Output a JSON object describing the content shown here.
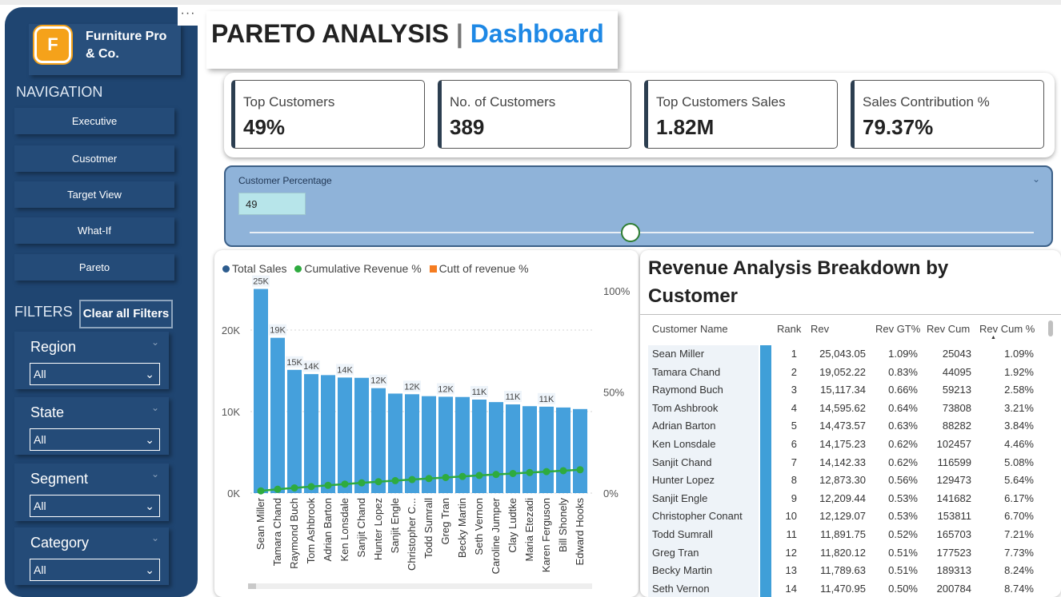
{
  "sidebar": {
    "more": "···",
    "logo_letter": "F",
    "company_line1": "Furniture Pro",
    "company_line2": "& Co.",
    "nav_title": "NAVIGATION",
    "nav": [
      "Executive",
      "Cusotmer",
      "Target View",
      "What-If",
      "Pareto"
    ],
    "filters_title": "FILTERS",
    "clear_label": "Clear all Filters",
    "filters": [
      {
        "label": "Region",
        "value": "All"
      },
      {
        "label": "State",
        "value": "All"
      },
      {
        "label": "Segment",
        "value": "All"
      },
      {
        "label": "Category",
        "value": "All"
      }
    ]
  },
  "header": {
    "main": "PARETO ANALYSIS",
    "sep": " | ",
    "sub": "Dashboard"
  },
  "kpis": [
    {
      "label": "Top Customers",
      "value": "49%"
    },
    {
      "label": "No. of Customers",
      "value": "389"
    },
    {
      "label": "Top Customers Sales",
      "value": "1.82M"
    },
    {
      "label": "Sales Contribution %",
      "value": "79.37%"
    }
  ],
  "slicer": {
    "title": "Customer Percentage",
    "value": "49",
    "position": 0.49
  },
  "colors": {
    "sidebar": "#1f4571",
    "bar": "#45a0dc",
    "cumulative": "#2eab3f",
    "cutoff": "#f57c21",
    "accent": "#1e88e5"
  },
  "chart_data": {
    "type": "bar",
    "legend": [
      "Total Sales",
      "Cumulative Revenue %",
      "Cutt of revenue %"
    ],
    "categories": [
      "Sean Miller",
      "Tamara Chand",
      "Raymond Buch",
      "Tom Ashbrook",
      "Adrian Barton",
      "Ken Lonsdale",
      "Sanjit Chand",
      "Hunter Lopez",
      "Sanjit Engle",
      "Christopher C...",
      "Todd Sumrall",
      "Greg Tran",
      "Becky Martin",
      "Seth Vernon",
      "Caroline Jumper",
      "Clay Ludtke",
      "Maria Etezadi",
      "Karen Ferguson",
      "Bill Shonely",
      "Edward Hooks"
    ],
    "series": [
      {
        "name": "Total Sales",
        "values": [
          25043,
          19052,
          15117,
          14596,
          14474,
          14175,
          14142,
          12873,
          12209,
          12129,
          11892,
          11820,
          11790,
          11471,
          11165,
          10880,
          10664,
          10604,
          10502,
          10311
        ]
      },
      {
        "name": "Cumulative Revenue %",
        "values": [
          1.09,
          1.92,
          2.58,
          3.21,
          3.84,
          4.46,
          5.08,
          5.64,
          6.17,
          6.7,
          7.21,
          7.73,
          8.24,
          8.74,
          9.23,
          9.7,
          10.17,
          10.63,
          11.09,
          11.54
        ]
      }
    ],
    "data_labels": [
      "25K",
      "19K",
      "15K",
      "14K",
      "",
      "14K",
      "",
      "12K",
      "",
      "12K",
      "",
      "12K",
      "",
      "11K",
      "",
      "11K",
      "",
      "11K",
      "",
      ""
    ],
    "y_ticks": [
      "0K",
      "10K",
      "20K"
    ],
    "y2_ticks": [
      "0%",
      "50%",
      "100%"
    ],
    "ylim": [
      0,
      25000
    ],
    "y2lim": [
      0,
      100
    ],
    "legend_position": "top-left"
  },
  "table": {
    "title": "Revenue Analysis Breakdown by Customer",
    "columns": [
      "Customer Name",
      "Rank",
      "Rev",
      "Rev GT%",
      "Rev Cum",
      "Rev Cum %"
    ],
    "rows": [
      [
        "Sean Miller",
        "1",
        "25,043.05",
        "1.09%",
        "25043",
        "1.09%"
      ],
      [
        "Tamara Chand",
        "2",
        "19,052.22",
        "0.83%",
        "44095",
        "1.92%"
      ],
      [
        "Raymond Buch",
        "3",
        "15,117.34",
        "0.66%",
        "59213",
        "2.58%"
      ],
      [
        "Tom Ashbrook",
        "4",
        "14,595.62",
        "0.64%",
        "73808",
        "3.21%"
      ],
      [
        "Adrian Barton",
        "5",
        "14,473.57",
        "0.63%",
        "88282",
        "3.84%"
      ],
      [
        "Ken Lonsdale",
        "6",
        "14,175.23",
        "0.62%",
        "102457",
        "4.46%"
      ],
      [
        "Sanjit Chand",
        "7",
        "14,142.33",
        "0.62%",
        "116599",
        "5.08%"
      ],
      [
        "Hunter Lopez",
        "8",
        "12,873.30",
        "0.56%",
        "129473",
        "5.64%"
      ],
      [
        "Sanjit Engle",
        "9",
        "12,209.44",
        "0.53%",
        "141682",
        "6.17%"
      ],
      [
        "Christopher Conant",
        "10",
        "12,129.07",
        "0.53%",
        "153811",
        "6.70%"
      ],
      [
        "Todd Sumrall",
        "11",
        "11,891.75",
        "0.52%",
        "165703",
        "7.21%"
      ],
      [
        "Greg Tran",
        "12",
        "11,820.12",
        "0.51%",
        "177523",
        "7.73%"
      ],
      [
        "Becky Martin",
        "13",
        "11,789.63",
        "0.51%",
        "189313",
        "8.24%"
      ],
      [
        "Seth Vernon",
        "14",
        "11,470.95",
        "0.50%",
        "200784",
        "8.74%"
      ]
    ],
    "rev_max": 25043.05
  }
}
